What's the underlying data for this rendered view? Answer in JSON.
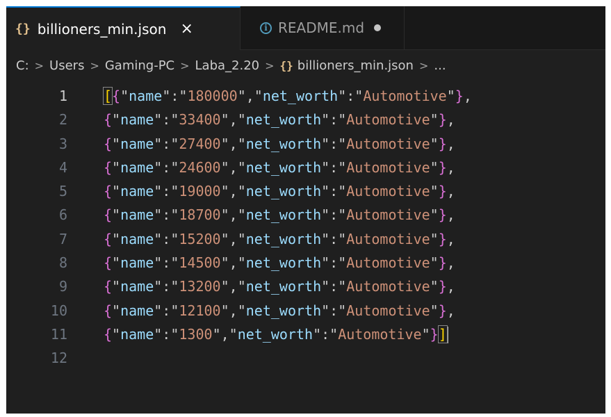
{
  "tabs": [
    {
      "label": "billioners_min.json",
      "icon": "json-braces-icon",
      "active": true,
      "close": "×"
    },
    {
      "label": "README.md",
      "icon": "info-icon",
      "active": false,
      "modified": true
    }
  ],
  "icons": {
    "json_glyph": "{}",
    "info_glyph": "i"
  },
  "breadcrumb": {
    "parts": [
      "C:",
      "Users",
      "Gaming-PC",
      "Laba_2.20",
      "billioners_min.json",
      "..."
    ],
    "separator": ">"
  },
  "editor": {
    "current_line": 1,
    "lines": [
      {
        "number": "1",
        "name": "180000",
        "net_worth": "Automotive"
      },
      {
        "number": "2",
        "name": "33400",
        "net_worth": "Automotive"
      },
      {
        "number": "3",
        "name": "27400",
        "net_worth": "Automotive"
      },
      {
        "number": "4",
        "name": "24600",
        "net_worth": "Automotive"
      },
      {
        "number": "5",
        "name": "19000",
        "net_worth": "Automotive"
      },
      {
        "number": "6",
        "name": "18700",
        "net_worth": "Automotive"
      },
      {
        "number": "7",
        "name": "15200",
        "net_worth": "Automotive"
      },
      {
        "number": "8",
        "name": "14500",
        "net_worth": "Automotive"
      },
      {
        "number": "9",
        "name": "13200",
        "net_worth": "Automotive"
      },
      {
        "number": "10",
        "name": "12100",
        "net_worth": "Automotive"
      },
      {
        "number": "11",
        "name": "1300",
        "net_worth": "Automotive"
      },
      {
        "number": "12"
      }
    ],
    "key_name": "name",
    "key_net_worth": "net_worth"
  },
  "colors": {
    "background": "#1f1f1f",
    "tab_accent": "#0078d4",
    "key": "#9cdcfe",
    "string": "#ce9178",
    "brace": "#da70d6",
    "bracket": "#ffd700"
  }
}
